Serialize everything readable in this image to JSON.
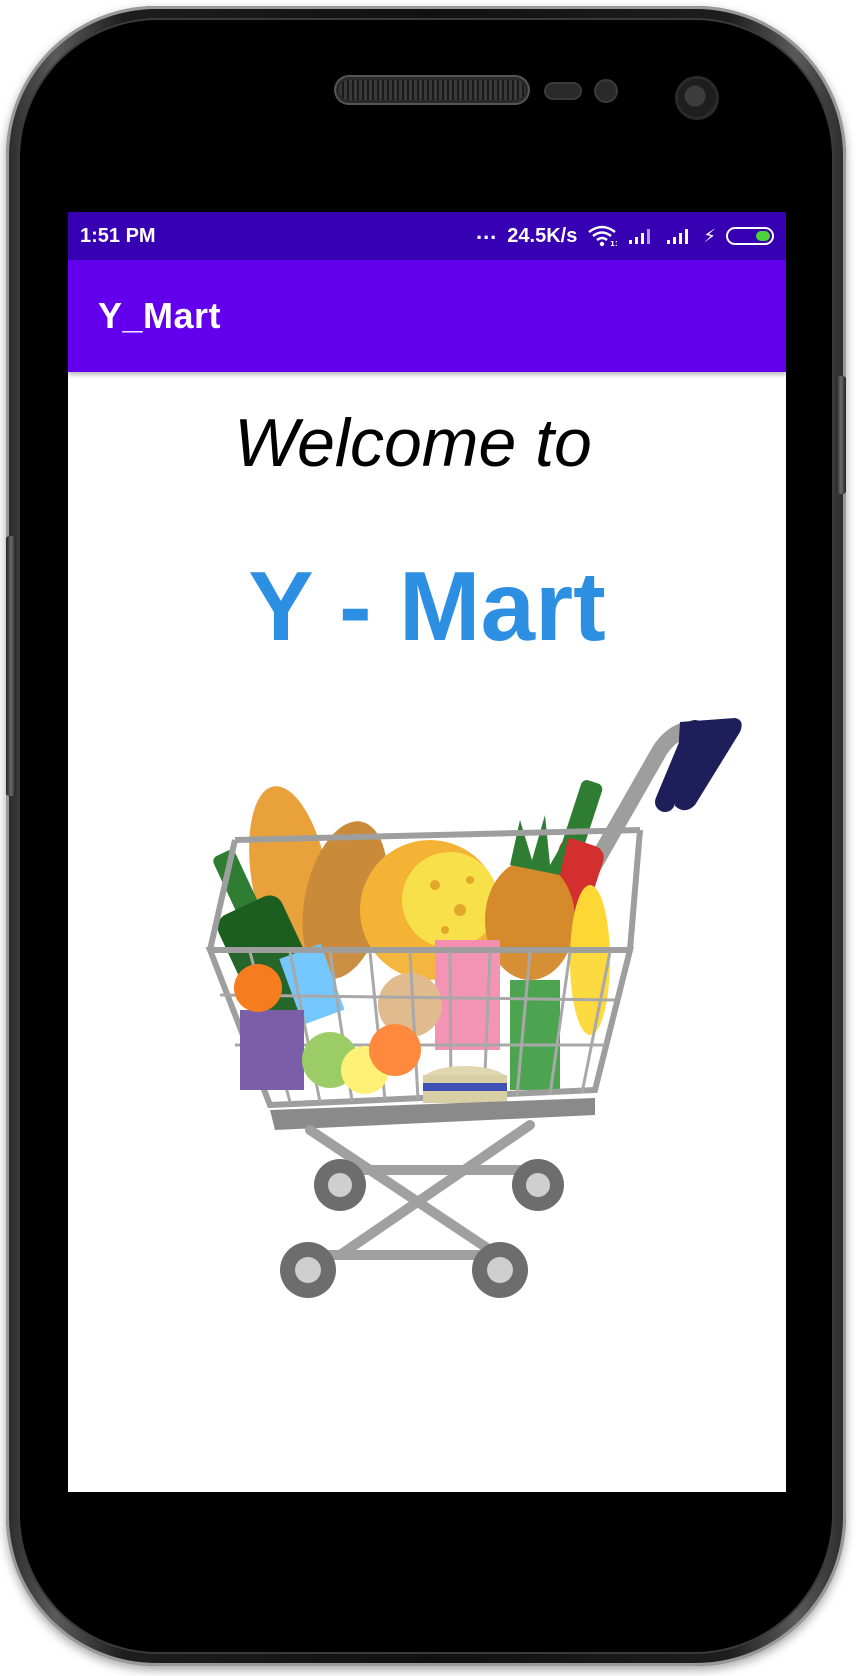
{
  "status_bar": {
    "time": "1:51 PM",
    "overflow": "...",
    "network_speed": "24.5K/s",
    "icons": [
      "wifi-icon",
      "signal-icon",
      "signal-icon",
      "charging-icon",
      "battery-icon"
    ]
  },
  "app_bar": {
    "title": "Y_Mart"
  },
  "main": {
    "welcome_text": "Welcome to",
    "brand_name": "Y - Mart",
    "illustration": "shopping-cart-with-groceries"
  },
  "colors": {
    "status_bar": "#3700b3",
    "app_bar": "#6200ee",
    "brand_text": "#2d8fe2",
    "battery_fill": "#4cd137"
  }
}
